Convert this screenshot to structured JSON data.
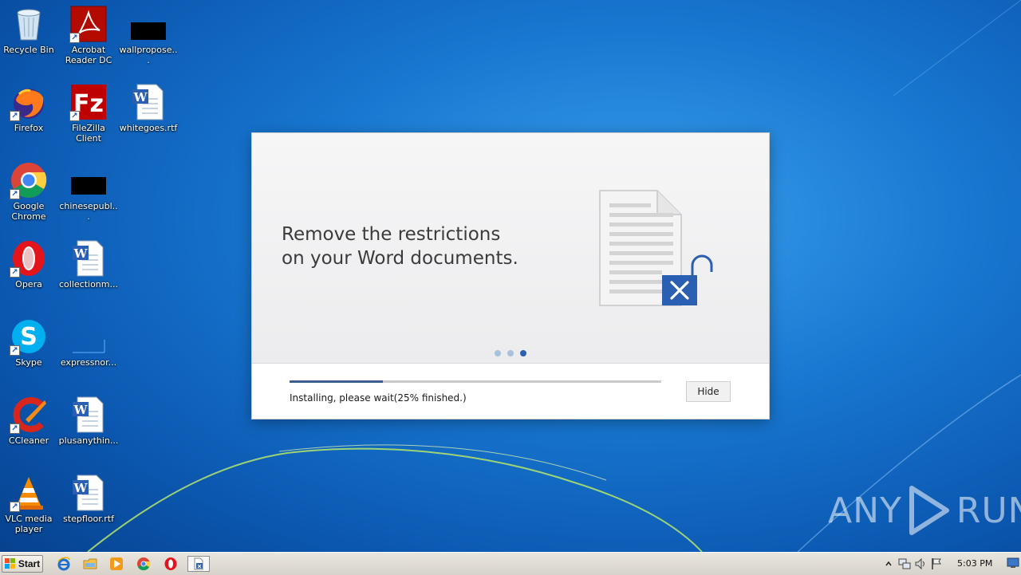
{
  "desktop": {
    "icons": [
      {
        "label": "Recycle Bin"
      },
      {
        "label": "Acrobat Reader DC"
      },
      {
        "label": "wallpropose..."
      },
      {
        "label": "Firefox"
      },
      {
        "label": "FileZilla Client"
      },
      {
        "label": "whitegoes.rtf"
      },
      {
        "label": "Google Chrome"
      },
      {
        "label": "chinesepubl..."
      },
      {
        "label": "Opera"
      },
      {
        "label": "collectionm..."
      },
      {
        "label": "Skype"
      },
      {
        "label": "expressnor..."
      },
      {
        "label": "CCleaner"
      },
      {
        "label": "plusanythin..."
      },
      {
        "label": "VLC media player"
      },
      {
        "label": "stepfloor.rtf"
      }
    ]
  },
  "installer": {
    "headline_line1": "Remove the restrictions",
    "headline_line2": "on your Word documents.",
    "slide_count": 3,
    "active_slide": 3,
    "progress_fraction": 0.25,
    "status_text": "Installing, please wait(25% finished.)",
    "hide_label": "Hide"
  },
  "watermark": {
    "text_left": "ANY",
    "text_right": "RUN"
  },
  "taskbar": {
    "start_label": "Start",
    "quick_launch": [
      "ie-icon",
      "explorer-icon",
      "media-player-icon",
      "chrome-icon",
      "opera-icon",
      "installer-icon"
    ],
    "clock": "5:03 PM"
  },
  "colors": {
    "accent_blue": "#2a5fb2",
    "progress_fill": "#3a5f8f",
    "headline_text": "#3b3b3b"
  }
}
